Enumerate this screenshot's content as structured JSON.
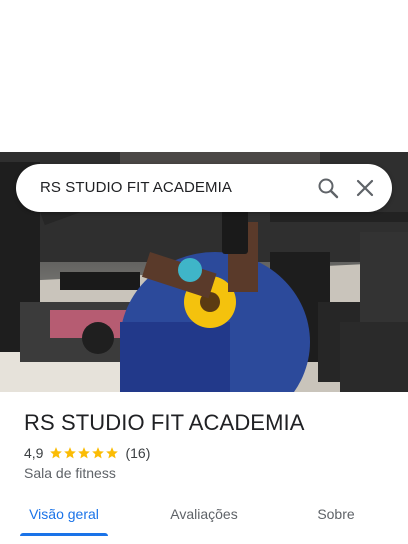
{
  "search": {
    "query": "RS STUDIO FIT ACADEMIA",
    "search_icon": "search-icon",
    "close_icon": "close-icon"
  },
  "place": {
    "photo_icon": "gym-selfie-photo",
    "name": "RS STUDIO FIT ACADEMIA",
    "rating": "4,9",
    "stars": 5,
    "review_count": "(16)",
    "category": "Sala de fitness"
  },
  "tabs": [
    {
      "label": "Visão geral",
      "active": true
    },
    {
      "label": "Avaliações",
      "active": false
    },
    {
      "label": "Sobre",
      "active": false
    }
  ],
  "colors": {
    "accent": "#1a73e8",
    "star": "#fbbc04",
    "text": "#202124",
    "secondary_text": "#5f6368"
  }
}
